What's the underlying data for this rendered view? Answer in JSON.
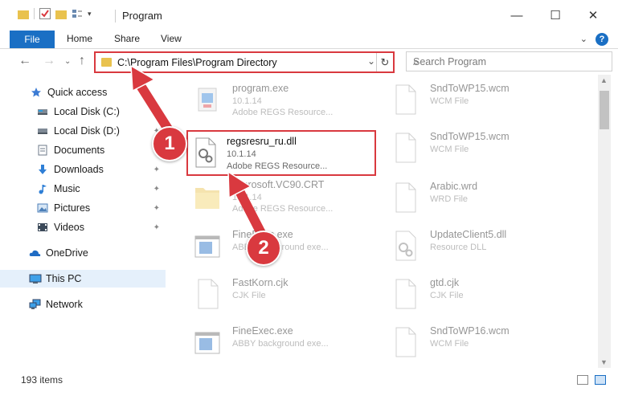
{
  "window": {
    "title": "Program",
    "minimize": "—",
    "maximize": "☐",
    "close": "✕"
  },
  "ribbon": {
    "file": "File",
    "tabs": [
      "Home",
      "Share",
      "View"
    ],
    "expand": "⌄",
    "help": "?"
  },
  "nav": {
    "back": "←",
    "forward": "→",
    "dropdown": "⌄",
    "up": "↑"
  },
  "address": {
    "path": "C:\\Program Files\\Program Directory",
    "dropdown": "⌄",
    "refresh": "↻"
  },
  "search": {
    "placeholder": "Search Program",
    "icon": "⌕"
  },
  "sidebar": {
    "items": [
      {
        "label": "Quick access",
        "icon": "star-icon",
        "pinned": false
      },
      {
        "label": "Local Disk (C:)",
        "icon": "drive-icon",
        "pinned": true
      },
      {
        "label": "Local Disk (D:)",
        "icon": "drive-icon",
        "pinned": true
      },
      {
        "label": "Documents",
        "icon": "documents-icon",
        "pinned": true
      },
      {
        "label": "Downloads",
        "icon": "download-icon",
        "pinned": true
      },
      {
        "label": "Music",
        "icon": "music-icon",
        "pinned": true
      },
      {
        "label": "Pictures",
        "icon": "pictures-icon",
        "pinned": true
      },
      {
        "label": "Videos",
        "icon": "videos-icon",
        "pinned": true
      },
      {
        "label": "OneDrive",
        "icon": "cloud-icon",
        "pinned": false
      },
      {
        "label": "This PC",
        "icon": "computer-icon",
        "pinned": false
      },
      {
        "label": "Network",
        "icon": "network-icon",
        "pinned": false
      }
    ],
    "pin_glyph": "📌"
  },
  "files": {
    "left": [
      {
        "name": "program.exe",
        "version": "10.1.14",
        "desc": "Adobe REGS Resource...",
        "icon": "exe-icon"
      },
      {
        "name": "regsresru_ru.dll",
        "version": "10.1.14",
        "desc": "Adobe REGS Resource...",
        "icon": "dll-gears-icon"
      },
      {
        "name": "Microsoft.VC90.CRT",
        "version": "10.1.14",
        "desc": "Adobe REGS Resource...",
        "icon": "folder-icon"
      },
      {
        "name": "FineExec.exe",
        "version": "",
        "desc": "ABBY background exe...",
        "icon": "app-window-icon"
      },
      {
        "name": "FastKorn.cjk",
        "version": "",
        "desc": "CJK File",
        "icon": "blank-file-icon"
      },
      {
        "name": "FineExec.exe",
        "version": "",
        "desc": "ABBY background exe...",
        "icon": "app-window-icon"
      }
    ],
    "right": [
      {
        "name": "SndToWP15.wcm",
        "desc": "WCM File",
        "icon": "blank-file-icon"
      },
      {
        "name": "SndToWP15.wcm",
        "desc": "WCM File",
        "icon": "blank-file-icon"
      },
      {
        "name": "Arabic.wrd",
        "desc": "WRD File",
        "icon": "blank-file-icon"
      },
      {
        "name": "UpdateClient5.dll",
        "desc": "Resource DLL",
        "icon": "dll-gears-icon"
      },
      {
        "name": "gtd.cjk",
        "desc": "CJK File",
        "icon": "blank-file-icon"
      },
      {
        "name": "SndToWP16.wcm",
        "desc": "WCM File",
        "icon": "blank-file-icon"
      }
    ]
  },
  "callouts": [
    "1",
    "2"
  ],
  "status": {
    "count": "193 items"
  },
  "colors": {
    "accent": "#1a6fc4",
    "highlight": "#d9393f"
  }
}
